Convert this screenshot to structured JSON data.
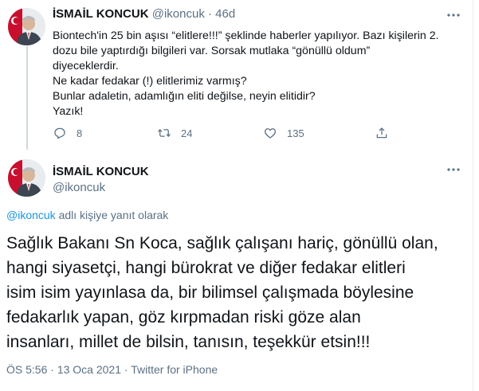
{
  "parent_tweet": {
    "author_name": "İSMAİL KONCUK",
    "author_handle": "@ikoncuk",
    "separator": "·",
    "age": "46d",
    "body_lines": [
      "Biontech'in 25 bin aşısı “elitlere!!!” şeklinde haberler yapılıyor. Bazı kişilerin 2.",
      "dozu bile yaptırdığı bilgileri var. Sorsak mutlaka “gönüllü oldum”",
      "diyeceklerdir.",
      "Ne kadar fedakar (!) elitlerimiz varmış?",
      "Bunlar adaletin, adamlığın eliti değilse, neyin elitidir?",
      "Yazık!"
    ],
    "reply_count": "8",
    "retweet_count": "24",
    "like_count": "135"
  },
  "main_tweet": {
    "author_name": "İSMAİL KONCUK",
    "author_handle": "@ikoncuk",
    "reply_to_mention": "@ikoncuk",
    "reply_to_suffix": " adlı kişiye yanıt olarak",
    "body_lines": [
      "Sağlık Bakanı Sn Koca, sağlık çalışanı hariç, gönüllü olan,",
      "hangi siyasetçi, hangi bürokrat ve diğer fedakar elitleri",
      "isim isim yayınlasa da, bir bilimsel çalışmada böylesine",
      "fedakarlık yapan, göz kırpmadan riski göze alan",
      "insanları, millet de bilsin, tanısın, teşekkür etsin!!!"
    ],
    "time": "ÖS 5:56",
    "date": "13 Oca 2021",
    "separator": "·",
    "source": "Twitter for iPhone"
  },
  "icons": {
    "more": "more-icon",
    "reply": "reply-icon",
    "retweet": "retweet-icon",
    "like": "like-icon",
    "share": "share-icon",
    "avatar": "avatar"
  },
  "colors": {
    "text": "#0f1419",
    "muted": "#5b7083",
    "link": "#1b95e0",
    "divider": "#ebeef0"
  }
}
